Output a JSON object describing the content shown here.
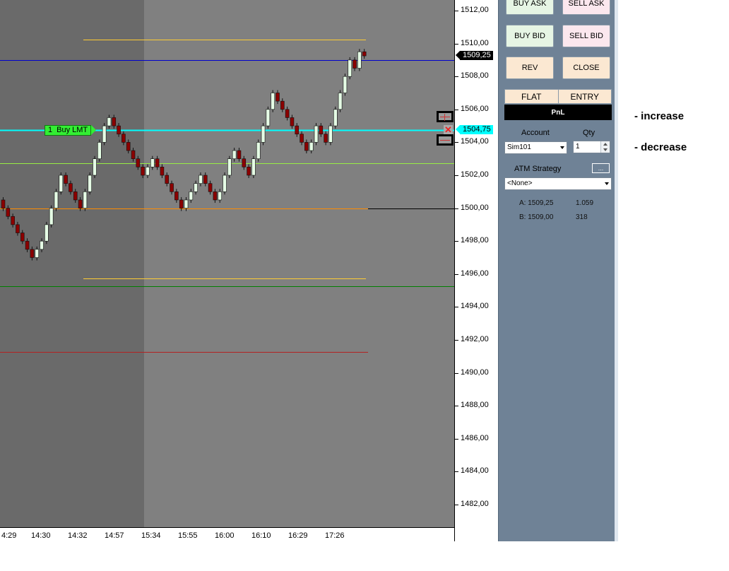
{
  "price_axis": {
    "ticks": [
      "1512,00",
      "1510,00",
      "1508,00",
      "1506,00",
      "1504,00",
      "1502,00",
      "1500,00",
      "1498,00",
      "1496,00",
      "1494,00",
      "1492,00",
      "1490,00",
      "1488,00",
      "1486,00",
      "1484,00",
      "1482,00"
    ]
  },
  "time_axis": {
    "ticks": [
      "4:29",
      "14:30",
      "14:32",
      "14:57",
      "15:34",
      "15:55",
      "16:00",
      "16:10",
      "16:29",
      "17:26"
    ]
  },
  "chart": {
    "last_price": "1509,25",
    "order_price": "1504,75",
    "order_qty": "1",
    "order_label": "Buy LMT",
    "colors": {
      "up_bar": "#e6ffe6",
      "down_bar": "#8b0000",
      "order_line": "#00ffff",
      "blue_line": "#0000cc",
      "gold_line": "#ffcc33",
      "lime_line": "#99ee44",
      "orange_line": "#ff8c00",
      "green_line": "#008000",
      "red_line": "#b22222"
    }
  },
  "chart_data": {
    "type": "candlestick",
    "price_range": [
      1481,
      1513
    ],
    "levels": [
      {
        "price": 1510.25,
        "color": "#ffcc33"
      },
      {
        "price": 1509.0,
        "color": "#0000cc"
      },
      {
        "price": 1504.75,
        "color": "#00ffff"
      },
      {
        "price": 1502.75,
        "color": "#99ee44"
      },
      {
        "price": 1500.0,
        "color": "#ff8c00"
      },
      {
        "price": 1495.75,
        "color": "#ffcc33"
      },
      {
        "price": 1495.25,
        "color": "#008000"
      },
      {
        "price": 1491.25,
        "color": "#b22222"
      }
    ],
    "closes": [
      1500.0,
      1499.5,
      1499.0,
      1498.5,
      1498.0,
      1497.5,
      1497.0,
      1497.5,
      1498.0,
      1499.0,
      1500.0,
      1501.0,
      1502.0,
      1501.5,
      1501.0,
      1500.5,
      1500.0,
      1501.0,
      1502.0,
      1503.0,
      1504.0,
      1505.0,
      1505.5,
      1505.0,
      1504.5,
      1504.0,
      1503.5,
      1503.0,
      1502.5,
      1502.0,
      1502.5,
      1503.0,
      1502.5,
      1502.0,
      1501.5,
      1501.0,
      1500.5,
      1500.0,
      1500.5,
      1501.0,
      1501.5,
      1502.0,
      1501.5,
      1501.0,
      1500.5,
      1501.0,
      1502.0,
      1503.0,
      1503.5,
      1503.0,
      1502.5,
      1502.0,
      1503.0,
      1504.0,
      1505.0,
      1506.0,
      1507.0,
      1506.5,
      1506.0,
      1505.5,
      1505.0,
      1504.5,
      1504.0,
      1503.5,
      1504.0,
      1505.0,
      1504.5,
      1504.0,
      1505.0,
      1506.0,
      1507.0,
      1508.0,
      1509.0,
      1508.5,
      1509.5,
      1509.25
    ]
  },
  "panel": {
    "buy_ask": "BUY ASK",
    "sell_ask": "SELL ASK",
    "buy_bid": "BUY BID",
    "sell_bid": "SELL BID",
    "rev": "REV",
    "close": "CLOSE",
    "flat": "FLAT",
    "entry": "ENTRY",
    "pnl": "PnL",
    "account_label": "Account",
    "qty_label": "Qty",
    "account_value": "Sim101",
    "qty_value": "1",
    "atm_label": "ATM Strategy",
    "atm_more": "...",
    "atm_value": "<None>",
    "ask_label": "A: 1509,25",
    "ask_size": "1.059",
    "bid_label": "B: 1509,00",
    "bid_size": "318"
  },
  "annotations": {
    "increase": "- increase",
    "decrease": "- decrease"
  }
}
